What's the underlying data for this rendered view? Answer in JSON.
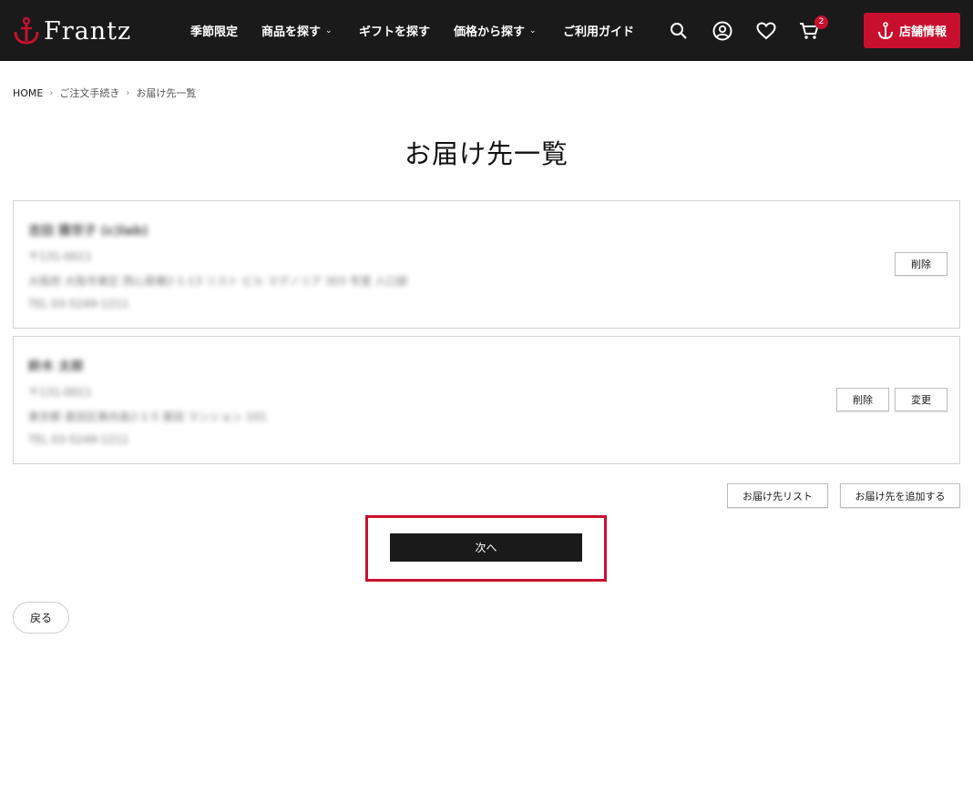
{
  "header": {
    "logo_text": "Frantz",
    "nav": [
      {
        "label": "季節限定",
        "has_dropdown": false
      },
      {
        "label": "商品を探す",
        "has_dropdown": true
      },
      {
        "label": "ギフトを探す",
        "has_dropdown": false
      },
      {
        "label": "価格から探す",
        "has_dropdown": true
      },
      {
        "label": "ご利用ガイド",
        "has_dropdown": false
      }
    ],
    "icons": [
      "search-icon",
      "account-icon",
      "heart-icon",
      "cart-icon"
    ],
    "cart_count": "2",
    "store_button_label": "店舗情報",
    "colors": {
      "header_bg": "#1a1a1a",
      "accent": "#c8102e"
    }
  },
  "breadcrumb": [
    "HOME",
    "ご注文手続き",
    "お届け先一覧"
  ],
  "page_title": "お届け先一覧",
  "addresses": [
    {
      "name": "吉田 雅世子 (c)lab)",
      "postal": "〒131-0011",
      "address": "大阪府 大阪市東区 西心斎橋2-1-13 リスト ビル マグノリア 303 号室 人口部",
      "phone": "TEL 03-5249-1211",
      "buttons": [
        "削除"
      ]
    },
    {
      "name": "鈴木 太郎",
      "postal": "〒131-0011",
      "address": "東京都 墨田区東向島2-1-5 墨田 マンション 101",
      "phone": "TEL 03-5249-1211",
      "buttons": [
        "削除",
        "変更"
      ]
    }
  ],
  "actions": {
    "list_label": "お届け先リスト",
    "add_label": "お届け先を追加する",
    "next_label": "次へ",
    "back_label": "戻る"
  }
}
